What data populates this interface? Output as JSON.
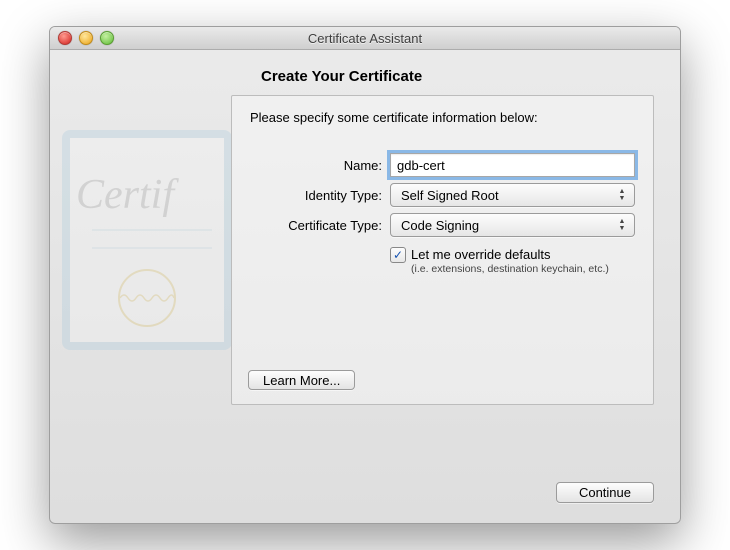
{
  "window": {
    "title": "Certificate Assistant"
  },
  "header": "Create Your Certificate",
  "panel": {
    "instruction": "Please specify some certificate information below:",
    "fields": {
      "name": {
        "label": "Name:",
        "value": "gdb-cert"
      },
      "identity": {
        "label": "Identity Type:",
        "value": "Self Signed Root"
      },
      "cert_type": {
        "label": "Certificate Type:",
        "value": "Code Signing"
      }
    },
    "override": {
      "checked": true,
      "label": "Let me override defaults",
      "sub": "(i.e. extensions, destination keychain, etc.)"
    },
    "learn_more": "Learn More..."
  },
  "footer": {
    "continue": "Continue"
  }
}
